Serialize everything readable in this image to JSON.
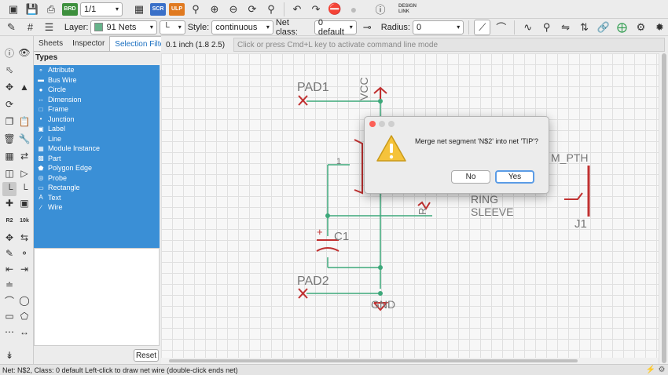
{
  "toolbar": {
    "sheet_select": "1/1",
    "scr_badge": "SCR",
    "ulp_badge": "ULP",
    "designlink_line1": "DESIGN",
    "designlink_line2": "LINK"
  },
  "props": {
    "layer_label": "Layer:",
    "layer_value": "91 Nets",
    "layer_color": "#66b38a",
    "style_label": "Style:",
    "style_value": "continuous",
    "netclass_label": "Net class:",
    "netclass_value": "0 default",
    "radius_label": "Radius:",
    "radius_value": "0"
  },
  "panel": {
    "tabs": [
      "Sheets",
      "Inspector",
      "Selection Filter"
    ],
    "active_tab": "Selection Filter",
    "types_title": "Types",
    "types": [
      {
        "label": "Attribute",
        "icon": "tag-icon"
      },
      {
        "label": "Bus Wire",
        "icon": "bus-icon"
      },
      {
        "label": "Circle",
        "icon": "circle-icon"
      },
      {
        "label": "Dimension",
        "icon": "dimension-icon"
      },
      {
        "label": "Frame",
        "icon": "frame-icon"
      },
      {
        "label": "Junction",
        "icon": "junction-icon"
      },
      {
        "label": "Label",
        "icon": "label-icon"
      },
      {
        "label": "Line",
        "icon": "line-icon"
      },
      {
        "label": "Module Instance",
        "icon": "module-icon"
      },
      {
        "label": "Part",
        "icon": "part-icon"
      },
      {
        "label": "Polygon Edge",
        "icon": "polygon-icon"
      },
      {
        "label": "Probe",
        "icon": "probe-icon"
      },
      {
        "label": "Rectangle",
        "icon": "rectangle-icon"
      },
      {
        "label": "Text",
        "icon": "text-icon"
      },
      {
        "label": "Wire",
        "icon": "wire-icon"
      }
    ],
    "reset_label": "Reset"
  },
  "coords": "0.1 inch (1.8 2.5)",
  "command_placeholder": "Click or press Cmd+L key to activate command line mode",
  "schematic": {
    "pad1": "PAD1",
    "pad2": "PAD2",
    "vcc": "VCC",
    "gnd": "GND",
    "c1": "C1",
    "r_partial": "R",
    "pin1": "1",
    "plus": "+",
    "jack_label": "M_PTH",
    "ring": "RING",
    "sleeve": "SLEEVE",
    "j1": "J1",
    "wire_color": "#3da87a",
    "part_color": "#c03030"
  },
  "dialog": {
    "message": "Merge net segment 'N$2' into net 'TIP'?",
    "no_label": "No",
    "yes_label": "Yes"
  },
  "status": {
    "text": "Net: N$2, Class: 0 default Left-click to draw net wire (double-click ends net)"
  }
}
